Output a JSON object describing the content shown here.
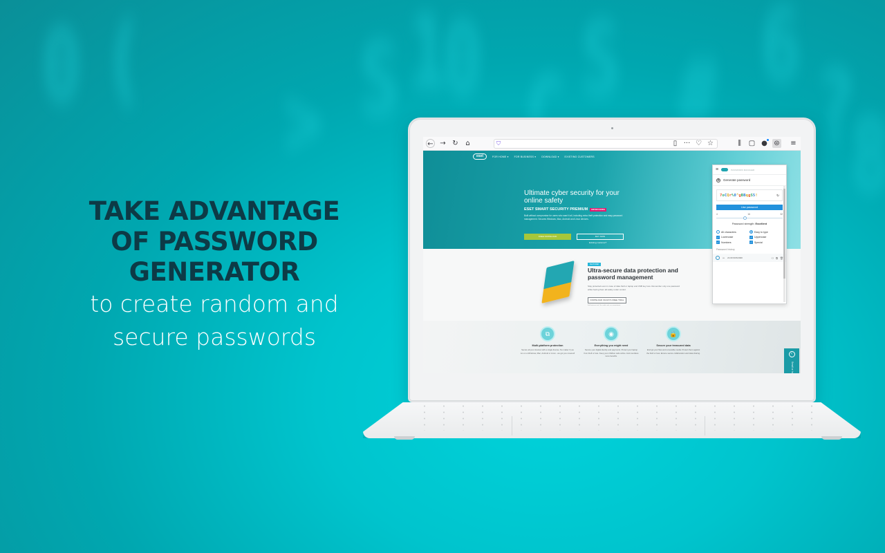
{
  "promo": {
    "headline_lines": [
      "TAKE ADVANTAGE",
      "OF PASSWORD",
      "GENERATOR"
    ],
    "subline_lines": [
      "to create random and",
      "secure passwords"
    ]
  },
  "background_glyphs": [
    "0",
    "(",
    ">",
    "S",
    "1",
    "0",
    "C",
    "S",
    "#",
    "6",
    "?",
    "8"
  ],
  "browser": {
    "toolbar": {
      "back_icon": "←",
      "forward_icon": "→",
      "reload_icon": "↻",
      "home_icon": "⌂",
      "url_value": "",
      "reader_icon": "▯",
      "more_icon": "···",
      "pocket_icon": "♡",
      "bookmark_icon": "☆",
      "library_icon": "⫼",
      "sidebar_icon": "▢",
      "account_icon": "●",
      "eset_ext_icon": "⊜",
      "menu_icon": "≡"
    },
    "site": {
      "logo_text": "eset",
      "nav": [
        "FOR HOME ▾",
        "FOR BUSINESS ▾",
        "DOWNLOAD ▾",
        "EXISTING CUSTOMERS"
      ],
      "hero_title": "Ultimate cyber security for your online safety",
      "product_name": "ESET SMART SECURITY PREMIUM",
      "product_badge": "EDITOR CHOICE",
      "hero_desc": "Built without compromise for users who want it all, including extra theft protection and easy password management. Secures Windows, Mac, Android and Linux devices.",
      "free_download": "FREE DOWNLOAD",
      "buy_now": "BUY NOW",
      "existing_customer": "Existing customer?",
      "section_tag": "FEATURED",
      "section_title": "Ultra-secure data protection and password management",
      "section_desc": "Stay protected even in case of data theft or laptop and USB key loss. Remember only one password while having them all safely under control.",
      "trial_button": "DOWNLOAD 30-DAYS FREE TRIAL",
      "trial_note": "Full features trial. No credit card, no commitment.",
      "features": [
        {
          "icon": "⧉",
          "title": "Multi-platform protection",
          "desc": "Secure all your devices with a single license. No matter if you run on a Windows, Mac, Android or Linux - we got you covered!"
        },
        {
          "icon": "◉",
          "title": "Everything you might need",
          "desc": "Secure your digital identity and payments. Protect your laptop from theft or loss. Keep your children safe online. And countless more benefits."
        },
        {
          "icon": "🔒",
          "title": "Secure your treasured data",
          "desc": "Encrypt your files and removable media. Protect them against the theft or loss. Ensure secure collaboration and data sharing."
        }
      ],
      "side_tab_label": "Small or home",
      "side_tab_icon": "‹"
    },
    "password_manager": {
      "menu_icon": "≡",
      "brand": "PASSWORD MANAGER",
      "generate_label": "Generate password",
      "generated_password": "7oCQr%8^gBBqgS5!",
      "refresh_icon": "↻",
      "use_password": "Use password",
      "length_min": "4",
      "length_value": "16",
      "length_max": "32",
      "length_fraction": 0.43,
      "strength_label": "Password strength:",
      "strength_value": "Excellent",
      "options": {
        "all_characters": {
          "label": "All characters",
          "selected": false
        },
        "easy_to_type": {
          "label": "Easy to type",
          "selected": true
        },
        "lowercase": {
          "label": "Lowercase",
          "checked": true
        },
        "uppercase": {
          "label": "Uppercase",
          "checked": true
        },
        "numbers": {
          "label": "Numbers",
          "checked": true
        },
        "special": {
          "label": "Special",
          "checked": true
        }
      },
      "history_label": "Password history",
      "history": [
        {
          "masked": "•••",
          "timestamp": "21:00 9/15/2020"
        }
      ]
    }
  },
  "colors": {
    "background": "#00c4cd",
    "headline": "#0d3a46",
    "hero_teal": "#1aa3ab",
    "use_button": "#2291dc",
    "free_download": "#a6c73a"
  }
}
